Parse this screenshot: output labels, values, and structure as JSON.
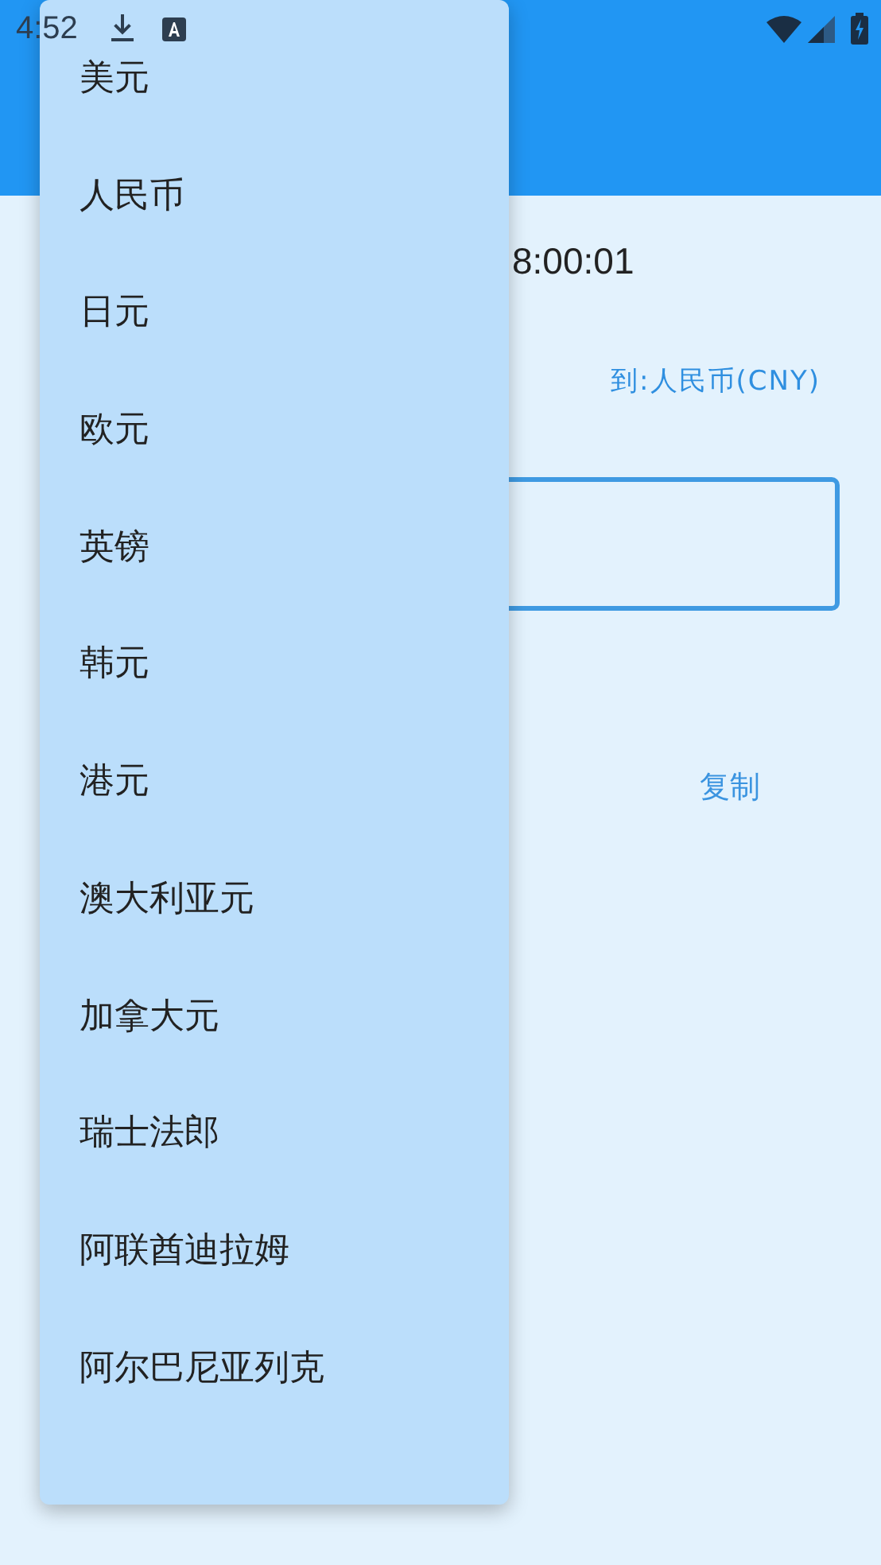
{
  "status_bar": {
    "time": "4:52"
  },
  "content": {
    "time_text": "8:00:01",
    "to_label": "到:人民币(CNY)",
    "copy_button": "复制"
  },
  "currency_menu": {
    "items": [
      "美元",
      "人民币",
      "日元",
      "欧元",
      "英镑",
      "韩元",
      "港元",
      "澳大利亚元",
      "加拿大元",
      "瑞士法郎",
      "阿联酋迪拉姆",
      "阿尔巴尼亚列克"
    ]
  }
}
